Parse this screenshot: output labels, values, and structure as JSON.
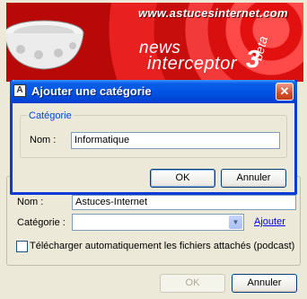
{
  "banner": {
    "site": "www.astucesinternet.com",
    "brand_line1": "news",
    "brand_line2": "interceptor",
    "brand_version": "3",
    "brand_tag": "beta"
  },
  "parent": {
    "name_label": "Nom :",
    "name_value": "Astuces-Internet",
    "category_label": "Catégorie :",
    "category_value": "",
    "add_link": "Ajouter",
    "download_checkbox_label": "Télécharger automatiquement les fichiers attachés (podcast)",
    "ok_label": "OK",
    "cancel_label": "Annuler"
  },
  "dialog": {
    "title": "Ajouter une catégorie",
    "group_title": "Catégorie",
    "name_label": "Nom :",
    "name_value": "Informatique",
    "ok_label": "OK",
    "cancel_label": "Annuler"
  },
  "colors": {
    "titlebar": "#0055e5",
    "banner_red": "#e31010",
    "group_legend": "#0046d5",
    "link": "#0000ff"
  }
}
